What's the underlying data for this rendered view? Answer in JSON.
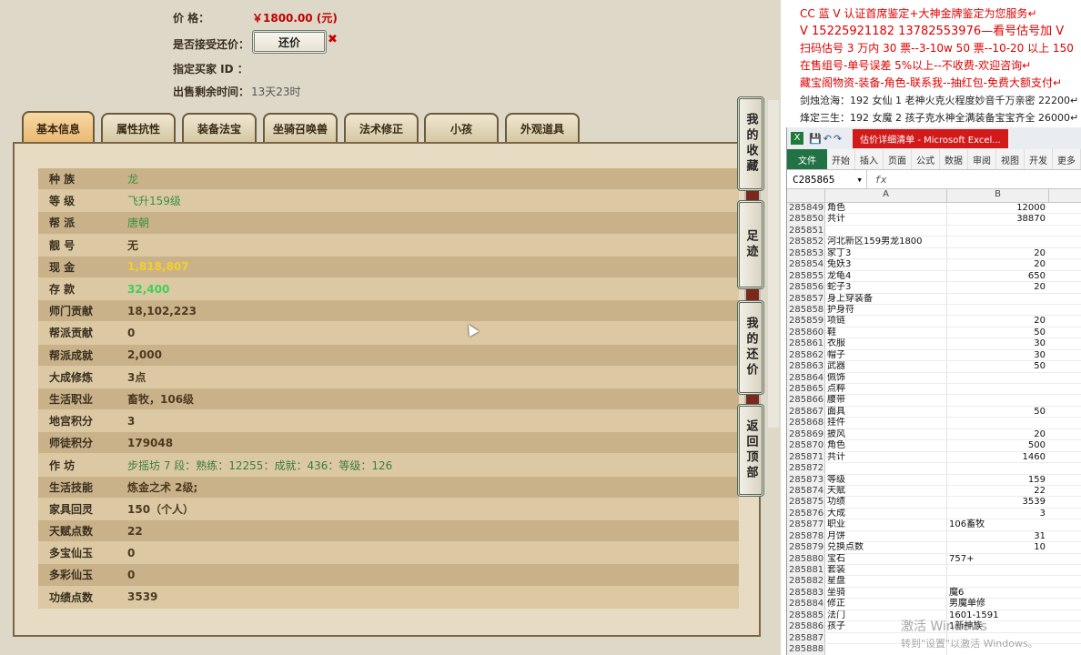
{
  "trade": {
    "price_label": "价      格：",
    "price_value": "￥1800.00 (元)",
    "accept_label": "是否接受还价：",
    "counter_button": "还价",
    "close_mark": "✖",
    "buyer_label": "指定买家 ID ：",
    "remain_label": "出售剩余时间：",
    "remain_value": "13天23时"
  },
  "tabs": [
    "基本信息",
    "属性抗性",
    "装备法宝",
    "坐骑召唤兽",
    "法术修正",
    "小孩",
    "外观道具"
  ],
  "active_tab": 0,
  "rows": [
    {
      "label": "种    族",
      "value": "龙",
      "style": "green"
    },
    {
      "label": "等    级",
      "value": "飞升159级",
      "style": "green"
    },
    {
      "label": "帮    派",
      "value": "唐朝",
      "style": "green"
    },
    {
      "label": "靓    号",
      "value": "无",
      "style": "normal"
    },
    {
      "label": "现    金",
      "value": "1,818,807",
      "style": "gold"
    },
    {
      "label": "存    款",
      "value": "32,400",
      "style": "bright"
    },
    {
      "label": "师门贡献",
      "value": "18,102,223",
      "style": "normal"
    },
    {
      "label": "帮派贡献",
      "value": "0",
      "style": "normal"
    },
    {
      "label": "帮派成就",
      "value": "2,000",
      "style": "normal"
    },
    {
      "label": "大成修炼",
      "value": "3点",
      "style": "normal"
    },
    {
      "label": "生活职业",
      "value": "畜牧，106级",
      "style": "normal"
    },
    {
      "label": "地宫积分",
      "value": "3",
      "style": "normal"
    },
    {
      "label": "师徒积分",
      "value": "179048",
      "style": "normal"
    },
    {
      "label": "作    坊",
      "value": "步摇坊 7 段：熟练：12255：成就：436：等级：126",
      "style": "sub"
    },
    {
      "label": "生活技能",
      "value": "炼金之术 2级;",
      "style": "normal"
    },
    {
      "label": "家具回灵",
      "value": "150（个人）",
      "style": "normal"
    },
    {
      "label": "天赋点数",
      "value": "22",
      "style": "normal"
    },
    {
      "label": "多宝仙玉",
      "value": "0",
      "style": "normal"
    },
    {
      "label": "多彩仙玉",
      "value": "0",
      "style": "normal"
    },
    {
      "label": "功绩点数",
      "value": "3539",
      "style": "normal"
    }
  ],
  "side_buttons": [
    "我的收藏",
    "足迹",
    "我的还价",
    "返回顶部"
  ],
  "notes": {
    "line1": "CC 蓝 V 认证首席鉴定+大神金牌鉴定为您服务↵",
    "line2": "V 15225921182      13782553976—看号估号加 V",
    "line3": "扫码估号 3 万内 30 票--3-10w 50 票--10-20 以上 150",
    "line4": "在售组号-单号误差 5%以上--不收费-欢迎咨询↵",
    "line5": "藏宝阁物资-装备-角色-联系我--抽红包-免费大额支付↵",
    "line6": "剑烛沧海：192 女仙 1 老神火克火程度妙音千万亲密 22200↵",
    "line7": "烽定三生：192 女魔 2 孩子克水神全满装备宝宝齐全 26000↵"
  },
  "excel": {
    "title": "估价详细清单 - Microsoft Excel...",
    "tabs": [
      "文件",
      "开始",
      "插入",
      "页面",
      "公式",
      "数据",
      "审阅",
      "视图",
      "开发",
      "更多"
    ],
    "name_box": "C285865",
    "fx": "fx",
    "col_a": "A",
    "col_b": "B",
    "rows": [
      {
        "n": "285849",
        "a": "角色",
        "b": "12000"
      },
      {
        "n": "285850",
        "a": "共计",
        "b": "38870"
      },
      {
        "n": "285851",
        "a": "",
        "b": ""
      },
      {
        "n": "285852",
        "a": "河北新区159男龙1800",
        "b": ""
      },
      {
        "n": "285853",
        "a": "家丁3",
        "b": "20"
      },
      {
        "n": "285854",
        "a": "兔妖3",
        "b": "20"
      },
      {
        "n": "285855",
        "a": "龙龟4",
        "b": "650"
      },
      {
        "n": "285856",
        "a": "蛇子3",
        "b": "20"
      },
      {
        "n": "285857",
        "a": "身上穿装备",
        "b": ""
      },
      {
        "n": "285858",
        "a": "护身符",
        "b": ""
      },
      {
        "n": "285859",
        "a": "项链",
        "b": "20"
      },
      {
        "n": "285860",
        "a": "鞋",
        "b": "50"
      },
      {
        "n": "285861",
        "a": "衣服",
        "b": "30"
      },
      {
        "n": "285862",
        "a": "帽子",
        "b": "30"
      },
      {
        "n": "285863",
        "a": "武器",
        "b": "50"
      },
      {
        "n": "285864",
        "a": "佩饰",
        "b": ""
      },
      {
        "n": "285865",
        "a": "点粹",
        "b": ""
      },
      {
        "n": "285866",
        "a": "腰带",
        "b": ""
      },
      {
        "n": "285867",
        "a": "面具",
        "b": "50"
      },
      {
        "n": "285868",
        "a": "挂件",
        "b": ""
      },
      {
        "n": "285869",
        "a": "披风",
        "b": "20"
      },
      {
        "n": "285870",
        "a": "角色",
        "b": "500"
      },
      {
        "n": "285871",
        "a": "共计",
        "b": "1460"
      },
      {
        "n": "285872",
        "a": "",
        "b": ""
      },
      {
        "n": "285873",
        "a": "等级",
        "b": "159"
      },
      {
        "n": "285874",
        "a": "天赋",
        "b": "22"
      },
      {
        "n": "285875",
        "a": "功绩",
        "b": "3539"
      },
      {
        "n": "285876",
        "a": "大成",
        "b": "3"
      },
      {
        "n": "285877",
        "a": "职业",
        "b": "106畜牧",
        "left": true
      },
      {
        "n": "285878",
        "a": "月饼",
        "b": "31"
      },
      {
        "n": "285879",
        "a": "兑换点数",
        "b": "10"
      },
      {
        "n": "285880",
        "a": "宝石",
        "b": "757+",
        "left": true
      },
      {
        "n": "285881",
        "a": "套装",
        "b": ""
      },
      {
        "n": "285882",
        "a": "星盘",
        "b": ""
      },
      {
        "n": "285883",
        "a": "坐骑",
        "b": "魔6",
        "left": true
      },
      {
        "n": "285884",
        "a": "修正",
        "b": "男魔单修",
        "left": true
      },
      {
        "n": "285885",
        "a": "法门",
        "b": "1601-1591",
        "left": true
      },
      {
        "n": "285886",
        "a": "孩子",
        "b": "1新神族",
        "left": true
      },
      {
        "n": "285887",
        "a": "",
        "b": ""
      },
      {
        "n": "285888",
        "a": "",
        "b": ""
      }
    ]
  },
  "watermark": {
    "line1": "激活 Windows",
    "line2": "转到\"设置\"以激活 Windows。"
  }
}
